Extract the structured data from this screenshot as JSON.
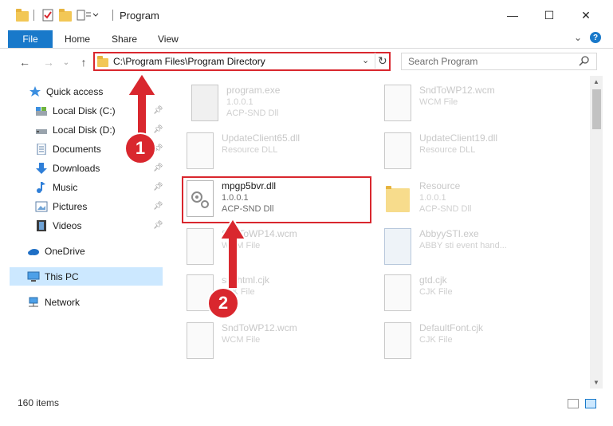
{
  "window": {
    "title": "Program",
    "minimize": "—",
    "maximize": "☐",
    "close": "✕"
  },
  "ribbon": {
    "file": "File",
    "tabs": [
      "Home",
      "Share",
      "View"
    ],
    "help": "?"
  },
  "address": {
    "path": "C:\\Program Files\\Program Directory",
    "search_placeholder": "Search Program"
  },
  "sidebar": {
    "items": [
      {
        "label": "Quick access",
        "pinned": false
      },
      {
        "label": "Local Disk (C:)",
        "pinned": true
      },
      {
        "label": "Local Disk (D:)",
        "pinned": true
      },
      {
        "label": "Documents",
        "pinned": true
      },
      {
        "label": "Downloads",
        "pinned": true
      },
      {
        "label": "Music",
        "pinned": true
      },
      {
        "label": "Pictures",
        "pinned": true
      },
      {
        "label": "Videos",
        "pinned": true
      },
      {
        "label": "OneDrive",
        "pinned": false
      },
      {
        "label": "This PC",
        "pinned": false,
        "selected": true
      },
      {
        "label": "Network",
        "pinned": false
      }
    ]
  },
  "files": [
    {
      "name": "program.exe",
      "line2": "1.0.0.1",
      "line3": "ACP-SND Dll",
      "icon": "exe-icon"
    },
    {
      "name": "SndToWP12.wcm",
      "line2": "WCM File",
      "line3": "",
      "icon": "file-icon"
    },
    {
      "name": "UpdateClient65.dll",
      "line2": "Resource DLL",
      "line3": "",
      "icon": "dll-gear-icon"
    },
    {
      "name": "UpdateClient19.dll",
      "line2": "Resource DLL",
      "line3": "",
      "icon": "dll-gear-icon"
    },
    {
      "name": "mpgp5bvr.dll",
      "line2": "1.0.0.1",
      "line3": "ACP-SND Dll",
      "icon": "dll-gear-icon",
      "highlighted": true
    },
    {
      "name": "Resource",
      "line2": "1.0.0.1",
      "line3": "ACP-SND Dll",
      "icon": "folder-icon"
    },
    {
      "name": "SndToWP14.wcm",
      "line2": "WCM File",
      "line3": "",
      "icon": "file-icon"
    },
    {
      "name": "AbbyySTI.exe",
      "line2": "ABBY sti event hand...",
      "line3": "",
      "icon": "exe-icon"
    },
    {
      "name": "sndhtml.cjk",
      "line2": "CJK File",
      "line3": "",
      "icon": "file-icon"
    },
    {
      "name": "gtd.cjk",
      "line2": "CJK File",
      "line3": "",
      "icon": "file-icon"
    },
    {
      "name": "SndToWP12.wcm",
      "line2": "WCM File",
      "line3": "",
      "icon": "file-icon"
    },
    {
      "name": "DefaultFont.cjk",
      "line2": "CJK File",
      "line3": "",
      "icon": "file-icon"
    }
  ],
  "annotations": {
    "step1": "1",
    "step2": "2",
    "accent": "#d9272e"
  },
  "status": {
    "count": "160 items"
  }
}
